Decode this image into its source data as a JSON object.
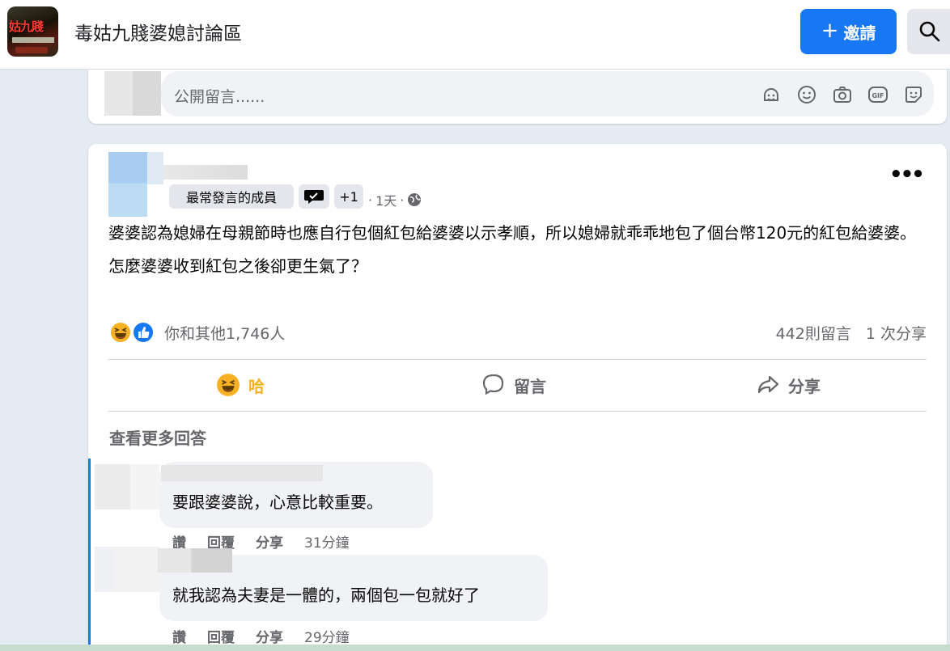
{
  "header": {
    "group_name": "毒姑九賤婆媳討論區",
    "logo_text": "姑九賤",
    "invite_label": "邀請",
    "invite_icon": "plus-icon",
    "search_icon": "search-icon"
  },
  "composer": {
    "placeholder": "公開留言......",
    "icons": [
      "avatar-sticker-icon",
      "emoji-icon",
      "camera-icon",
      "gif-icon",
      "sticker-icon"
    ]
  },
  "post": {
    "badge": "最常發言的成員",
    "plus_badges": "+1",
    "time": "1天",
    "audience_icon": "globe-icon",
    "body": [
      "婆婆認為媳婦在母親節時也應自行包個紅包給婆婆以示孝順，所以媳婦就乖乖地包了個台幣120元的紅包給婆婆。",
      "怎麼婆婆收到紅包之後卻更生氣了？"
    ],
    "reactors": "你和其他1,746人",
    "comment_count": "442則留言",
    "share_count": "1 次分享",
    "actions": {
      "haha": "哈",
      "comment": "留言",
      "share": "分享"
    },
    "view_more": "查看更多回答"
  },
  "comments": [
    {
      "text": "要跟婆婆說，心意比較重要。",
      "like": "讚",
      "reply": "回覆",
      "share": "分享",
      "time": "31分鐘"
    },
    {
      "text": "就我認為夫妻是一體的，兩個包一包就好了",
      "like": "讚",
      "reply": "回覆",
      "share": "分享",
      "time": "29分鐘"
    }
  ],
  "colors": {
    "accent": "#1877f2",
    "haha": "#f7b125",
    "secondary_text": "#65676b"
  }
}
